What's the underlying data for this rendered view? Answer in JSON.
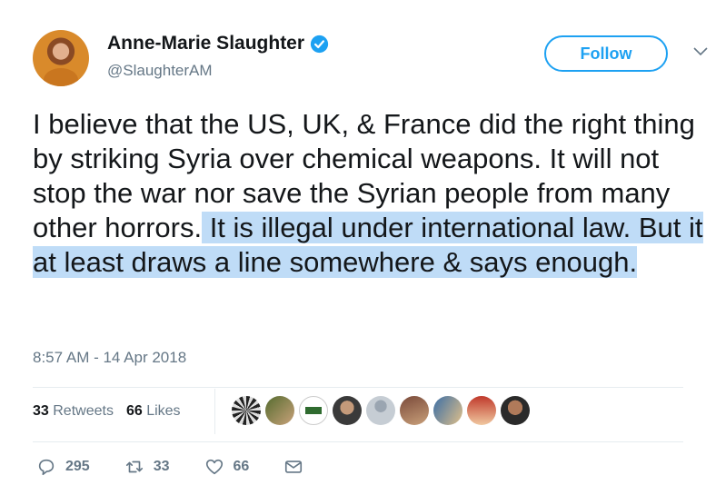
{
  "author": {
    "name": "Anne-Marie Slaughter",
    "handle": "@SlaughterAM"
  },
  "follow_button": {
    "label": "Follow"
  },
  "tweet": {
    "text_plain": "I believe that the US, UK, & France did the right thing by striking Syria over chemical weapons. It will not stop the war nor save the Syrian people from many other horrors.",
    "text_highlighted": " It is illegal under international law. But it at least draws a line somewhere & says enough.",
    "timestamp": "8:57 AM - 14 Apr 2018"
  },
  "stats": {
    "retweets_count": "33",
    "retweets_label": "Retweets",
    "likes_count": "66",
    "likes_label": "Likes"
  },
  "actions": {
    "replies": "295",
    "retweets": "33",
    "likes": "66"
  },
  "colors": {
    "brand": "#1da1f2",
    "highlight": "#bfdcf7",
    "secondary_text": "#657786"
  }
}
